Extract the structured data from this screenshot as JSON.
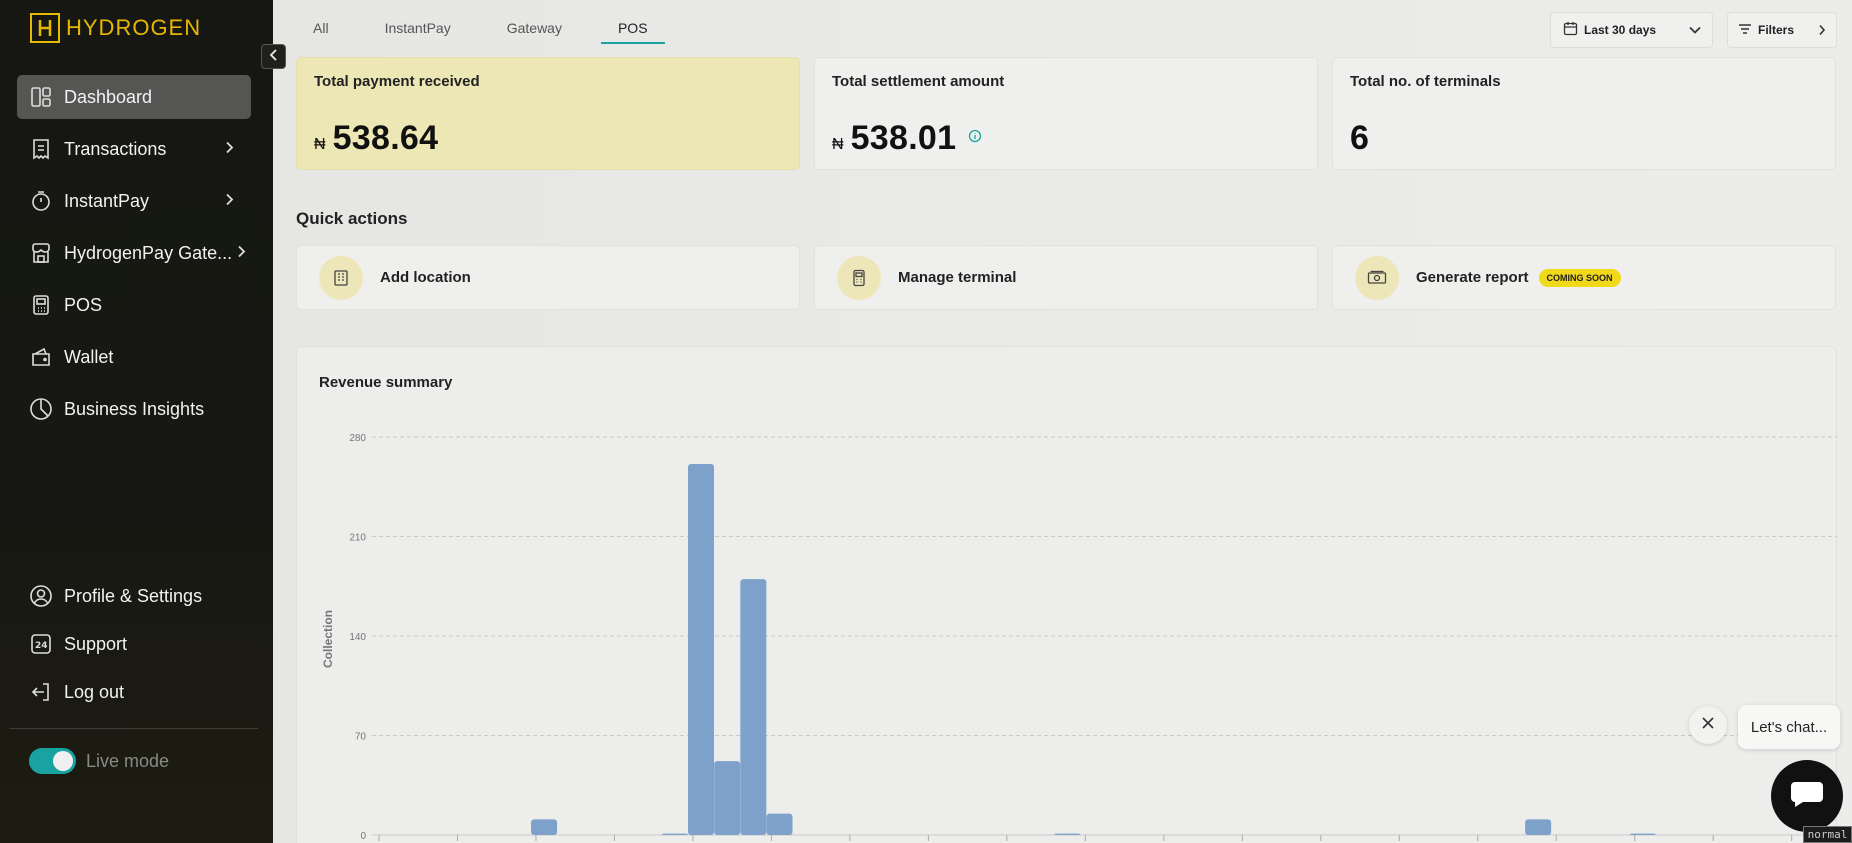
{
  "brand": {
    "name": "HYDROGEN",
    "accent": "#e6b800"
  },
  "sidebar": {
    "items": [
      {
        "label": "Dashboard",
        "icon": "dashboard-icon",
        "active": true
      },
      {
        "label": "Transactions",
        "icon": "receipt-icon",
        "chevron": true
      },
      {
        "label": "InstantPay",
        "icon": "timer-icon",
        "chevron": true
      },
      {
        "label": "HydrogenPay Gate...",
        "icon": "gateway-icon",
        "chevron": true
      },
      {
        "label": "POS",
        "icon": "pos-icon"
      },
      {
        "label": "Wallet",
        "icon": "wallet-icon"
      },
      {
        "label": "Business Insights",
        "icon": "pie-chart-icon"
      }
    ],
    "bottom": [
      {
        "label": "Profile & Settings",
        "icon": "user-icon"
      },
      {
        "label": "Support",
        "icon": "support-24-icon"
      },
      {
        "label": "Log out",
        "icon": "logout-icon"
      }
    ],
    "live_mode": {
      "label": "Live mode",
      "on": true,
      "color": "#18a3a0"
    }
  },
  "tabs": [
    {
      "label": "All"
    },
    {
      "label": "InstantPay"
    },
    {
      "label": "Gateway"
    },
    {
      "label": "POS",
      "active": true
    }
  ],
  "date_filter": {
    "label": "Last 30 days"
  },
  "filters": {
    "label": "Filters"
  },
  "cards": [
    {
      "title": "Total payment received",
      "currency": "₦",
      "value": "538.64"
    },
    {
      "title": "Total settlement amount",
      "currency": "₦",
      "value": "538.01"
    },
    {
      "title": "Total no. of terminals",
      "currency": "",
      "value": "6"
    }
  ],
  "quick_actions": {
    "title": "Quick actions",
    "items": [
      {
        "label": "Add location",
        "icon": "building-icon"
      },
      {
        "label": "Manage terminal",
        "icon": "terminal-icon"
      },
      {
        "label": "Generate report",
        "icon": "cash-icon",
        "badge": "COMING SOON"
      }
    ]
  },
  "revenue": {
    "title": "Revenue summary",
    "chart_data": {
      "type": "bar",
      "ylabel": "Collection",
      "ylim": [
        0,
        280
      ],
      "yticks": [
        0,
        70,
        140,
        210,
        280
      ],
      "values": [
        0,
        0,
        0,
        0,
        0,
        0,
        11,
        0,
        0,
        0,
        0,
        1,
        261,
        52,
        180,
        15,
        0,
        0,
        0,
        0,
        0,
        0,
        0,
        0,
        0,
        0,
        1,
        0,
        0,
        0,
        0,
        0,
        0,
        0,
        0,
        0,
        0,
        0,
        0,
        0,
        0,
        0,
        0,
        0,
        11,
        0,
        0,
        0,
        1,
        0,
        0,
        0,
        0,
        0,
        0,
        0
      ],
      "bar_color": "#7ea1cc"
    }
  },
  "chat": {
    "bubble": "Let's chat..."
  },
  "mode_tag": "normal"
}
